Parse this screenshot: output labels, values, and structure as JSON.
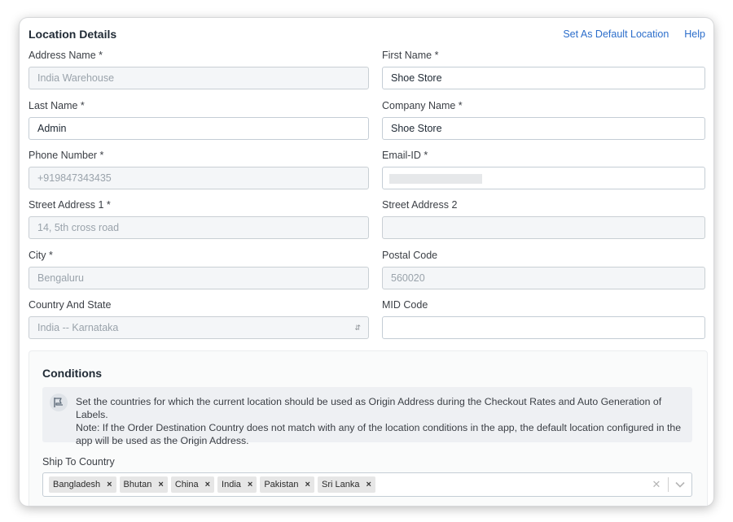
{
  "header": {
    "title": "Location Details",
    "set_default_link": "Set As Default Location",
    "help_link": "Help"
  },
  "form": {
    "address_name": {
      "label": "Address Name *",
      "placeholder": "India Warehouse"
    },
    "first_name": {
      "label": "First Name *",
      "value": "Shoe Store"
    },
    "last_name": {
      "label": "Last Name *",
      "value": "Admin"
    },
    "company_name": {
      "label": "Company Name *",
      "value": "Shoe Store"
    },
    "phone_number": {
      "label": "Phone Number *",
      "placeholder": "+919847343435"
    },
    "email": {
      "label": "Email-ID *",
      "value": ""
    },
    "street1": {
      "label": "Street Address 1 *",
      "placeholder": "14, 5th cross road"
    },
    "street2": {
      "label": "Street Address 2",
      "value": ""
    },
    "city": {
      "label": "City *",
      "placeholder": "Bengaluru"
    },
    "postal_code": {
      "label": "Postal Code",
      "placeholder": "560020"
    },
    "country_state": {
      "label": "Country And State",
      "value": "India -- Karnataka"
    },
    "mid_code": {
      "label": "MID Code",
      "value": ""
    }
  },
  "conditions": {
    "title": "Conditions",
    "notice_line1": "Set the countries for which the current location should be used as Origin Address during the Checkout Rates and Auto Generation of Labels.",
    "notice_line2": "Note: If the Order Destination Country does not match with any of the location conditions in the app, the default location configured in the app will be used as the Origin  Address.",
    "ship_to_label": "Ship To Country",
    "countries": [
      "Bangladesh",
      "Bhutan",
      "China",
      "India",
      "Pakistan",
      "Sri Lanka"
    ]
  },
  "icons": {
    "remove": "×",
    "clear": "✕",
    "select_arrows": "⌃⌄"
  }
}
